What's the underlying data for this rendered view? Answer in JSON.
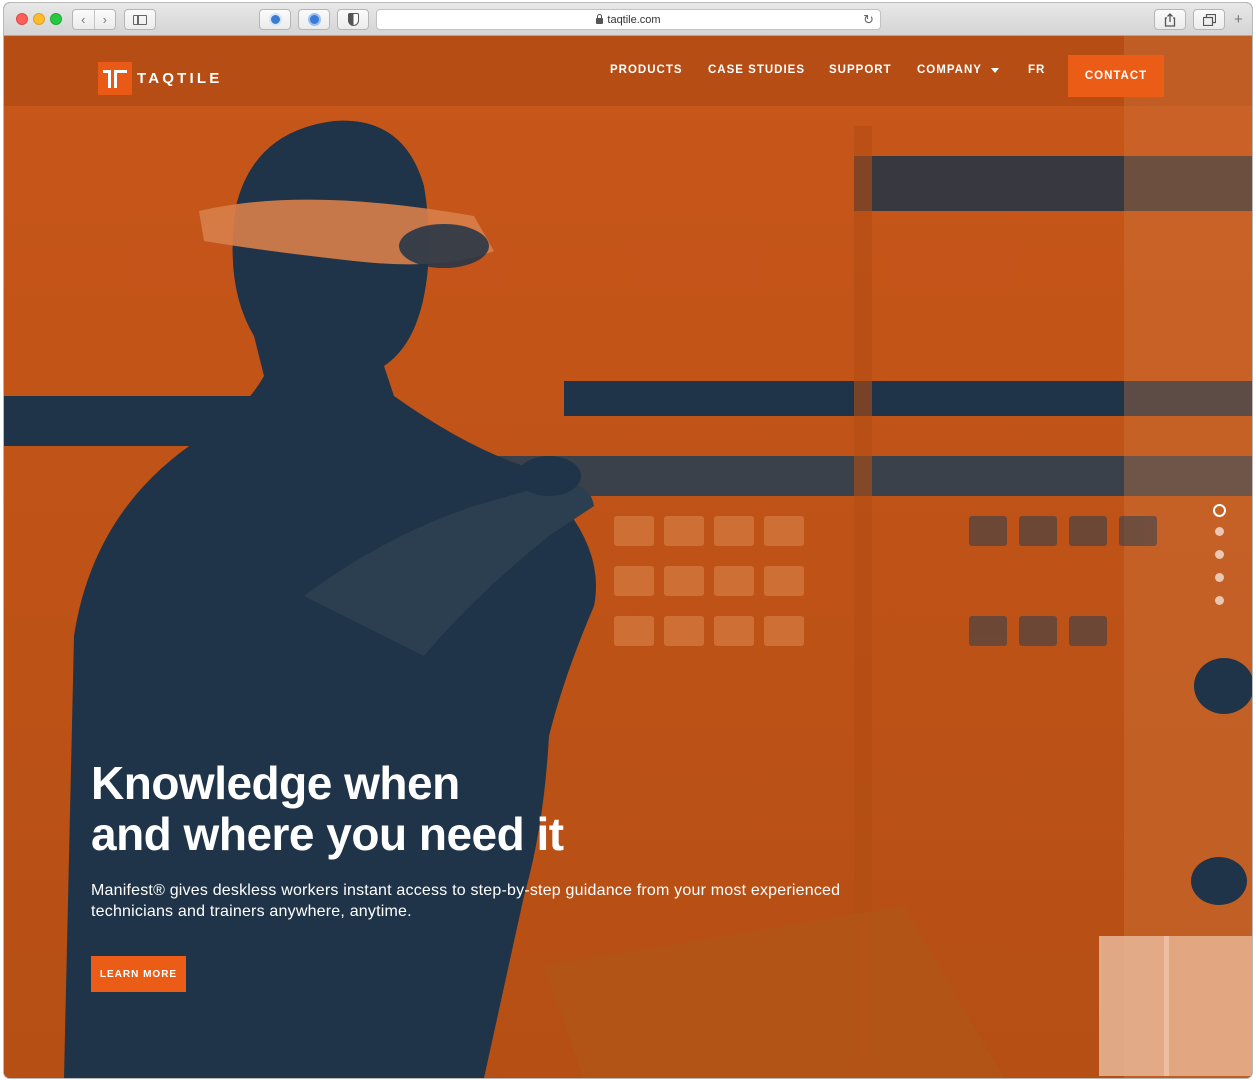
{
  "browser": {
    "url": "taqtile.com",
    "nav_back": "‹",
    "nav_forward": "›",
    "reload": "↻",
    "new_tab": "+",
    "icons": [
      "back-icon",
      "forward-icon",
      "sidebar-icon",
      "extension-icon",
      "password-manager-icon",
      "shield-icon",
      "lock-icon",
      "reload-icon",
      "share-icon",
      "tabs-overview-icon",
      "new-tab-icon"
    ]
  },
  "site": {
    "logo_text": "TAQTILE",
    "nav": {
      "products": "PRODUCTS",
      "case_studies": "CASE STUDIES",
      "support": "SUPPORT",
      "company": "COMPANY",
      "language": "FR"
    },
    "contact_label": "CONTACT",
    "hero": {
      "headline_line1": "Knowledge when",
      "headline_line2": "and where you need it",
      "subtext_line1": "Manifest® gives deskless workers instant access to step-by-step guidance from your most experienced",
      "subtext_line2": "technicians and trainers anywhere, anytime.",
      "cta_label": "LEARN MORE",
      "slides_total": 5,
      "slide_active": 1
    },
    "colors": {
      "brand_orange": "#eb5c16",
      "hero_orange": "#c35716",
      "hero_navy": "#1f3448",
      "text": "#ffffff"
    }
  }
}
